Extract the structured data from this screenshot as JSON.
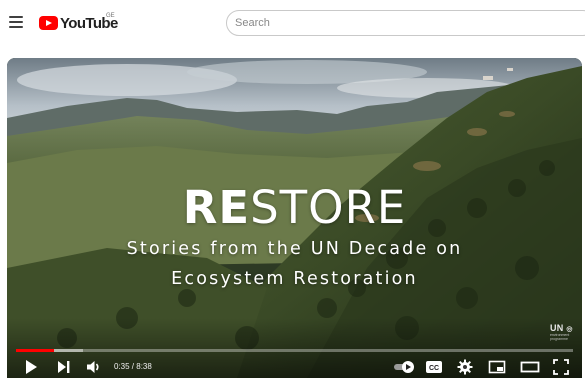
{
  "header": {
    "logo_text": "YouTube",
    "region_code": "GE",
    "search_placeholder": "Search"
  },
  "video": {
    "title_part_bold": "RE",
    "title_part_light": "STORE",
    "subtitle_line1": "Stories from the UN Decade on",
    "subtitle_line2": "Ecosystem Restoration",
    "watermark_logo": "UN",
    "watermark_sub": "environment programme"
  },
  "player": {
    "current_time": "0:35",
    "separator": " / ",
    "duration": "8:38",
    "progress_fraction": 0.068,
    "buffer_fraction": 0.12,
    "accent_color": "#ff0000",
    "icons": [
      "play-icon",
      "next-icon",
      "volume-icon",
      "autoplay-toggle-icon",
      "captions-icon",
      "settings-icon",
      "miniplayer-icon",
      "theater-mode-icon",
      "fullscreen-icon"
    ]
  }
}
